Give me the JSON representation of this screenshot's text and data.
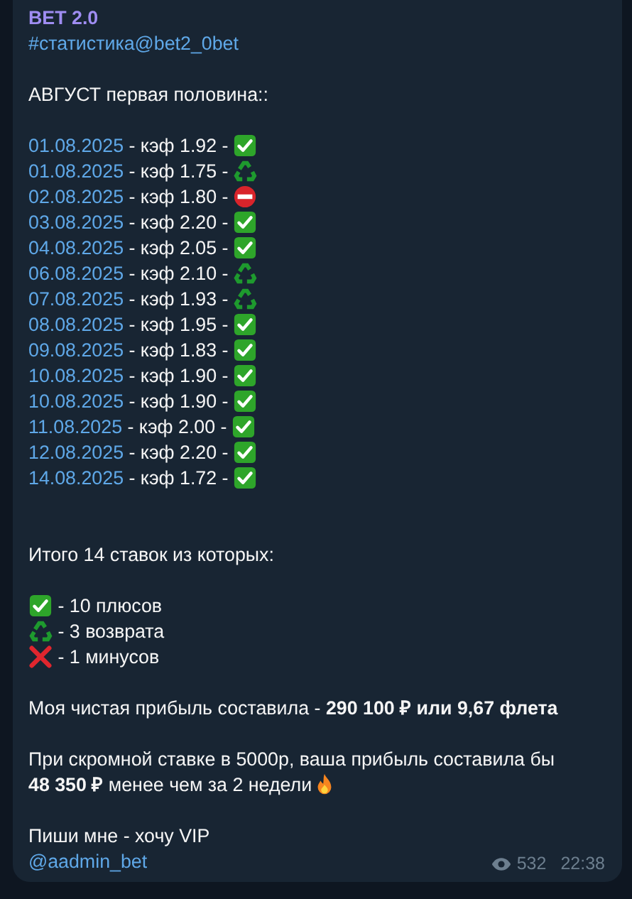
{
  "channel": {
    "name": "BET 2.0",
    "tag_line": "#статистика@bet2_0bet"
  },
  "heading": "АВГУСТ первая половина::",
  "bets": [
    {
      "date": "01.08.2025",
      "text": " - кэф 1.92 - ",
      "kind": "win"
    },
    {
      "date": "01.08.2025",
      "text": " - кэф 1.75 - ",
      "kind": "refund"
    },
    {
      "date": "02.08.2025",
      "text": " - кэф 1.80 - ",
      "kind": "loss"
    },
    {
      "date": "03.08.2025",
      "text": " - кэф 2.20 - ",
      "kind": "win"
    },
    {
      "date": "04.08.2025",
      "text": " - кэф 2.05 - ",
      "kind": "win"
    },
    {
      "date": "06.08.2025",
      "text": " - кэф 2.10 - ",
      "kind": "refund"
    },
    {
      "date": "07.08.2025",
      "text": " - кэф 1.93 - ",
      "kind": "refund"
    },
    {
      "date": "08.08.2025",
      "text": " - кэф 1.95 - ",
      "kind": "win"
    },
    {
      "date": "09.08.2025",
      "text": " - кэф 1.83 - ",
      "kind": "win"
    },
    {
      "date": "10.08.2025",
      "text": " - кэф 1.90 - ",
      "kind": "win"
    },
    {
      "date": "10.08.2025",
      "text": " - кэф 1.90 - ",
      "kind": "win"
    },
    {
      "date": "11.08.2025",
      "text": " - кэф 2.00 - ",
      "kind": "win"
    },
    {
      "date": "12.08.2025",
      "text": " - кэф 2.20 - ",
      "kind": "win"
    },
    {
      "date": "14.08.2025",
      "text": " - кэф 1.72 - ",
      "kind": "win"
    }
  ],
  "summary": "Итого 14 ставок из которых:",
  "legend": [
    {
      "kind": "win",
      "text": " - 10 плюсов"
    },
    {
      "kind": "refund",
      "text": " - 3 возврата"
    },
    {
      "kind": "cross",
      "text": " - 1 минусов"
    }
  ],
  "profit": "Моя чистая прибыль составила - **290 100 ₽ или 9,67 флета**",
  "example": {
    "line_1": "При скромной ставке в 5000р, ваша прибыль составила бы",
    "line_2": "**48 350 ₽** менее чем за 2 недели"
  },
  "cta": "Пиши мне - хочу VIP",
  "contact": "@aadmin_bet",
  "footer": {
    "views": "532",
    "time": "22:38"
  }
}
